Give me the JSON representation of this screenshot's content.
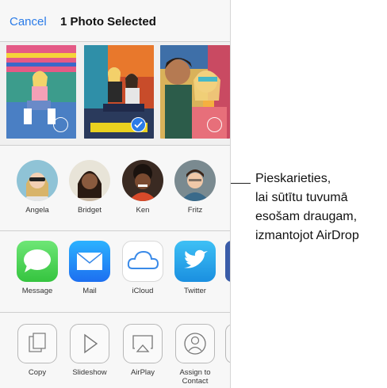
{
  "navbar": {
    "cancel_label": "Cancel",
    "title": "1 Photo Selected"
  },
  "photos": [
    {
      "name": "photo-1",
      "selected": false
    },
    {
      "name": "photo-2",
      "selected": true
    },
    {
      "name": "photo-3",
      "selected": false
    }
  ],
  "airdrop_people": [
    {
      "label": "Angela"
    },
    {
      "label": "Bridget"
    },
    {
      "label": "Ken"
    },
    {
      "label": "Fritz"
    }
  ],
  "share_apps": [
    {
      "label": "Message",
      "icon": "message-icon",
      "color": "#4cd964"
    },
    {
      "label": "Mail",
      "icon": "mail-icon",
      "color": "#1e90ff"
    },
    {
      "label": "iCloud",
      "icon": "icloud-icon",
      "color": "#ffffff"
    },
    {
      "label": "Twitter",
      "icon": "twitter-icon",
      "color": "#1da1f2"
    }
  ],
  "actions": [
    {
      "label": "Copy",
      "icon": "copy-icon"
    },
    {
      "label": "Slideshow",
      "icon": "play-icon"
    },
    {
      "label": "AirPlay",
      "icon": "airplay-icon"
    },
    {
      "label": "Assign to Contact",
      "icon": "contact-icon"
    }
  ],
  "callout": {
    "lines": [
      "Pieskarieties,",
      "lai sūtītu tuvumā",
      "esošam draugam,",
      "izmantojot AirDrop"
    ]
  },
  "colors": {
    "accent": "#2a7be8"
  }
}
